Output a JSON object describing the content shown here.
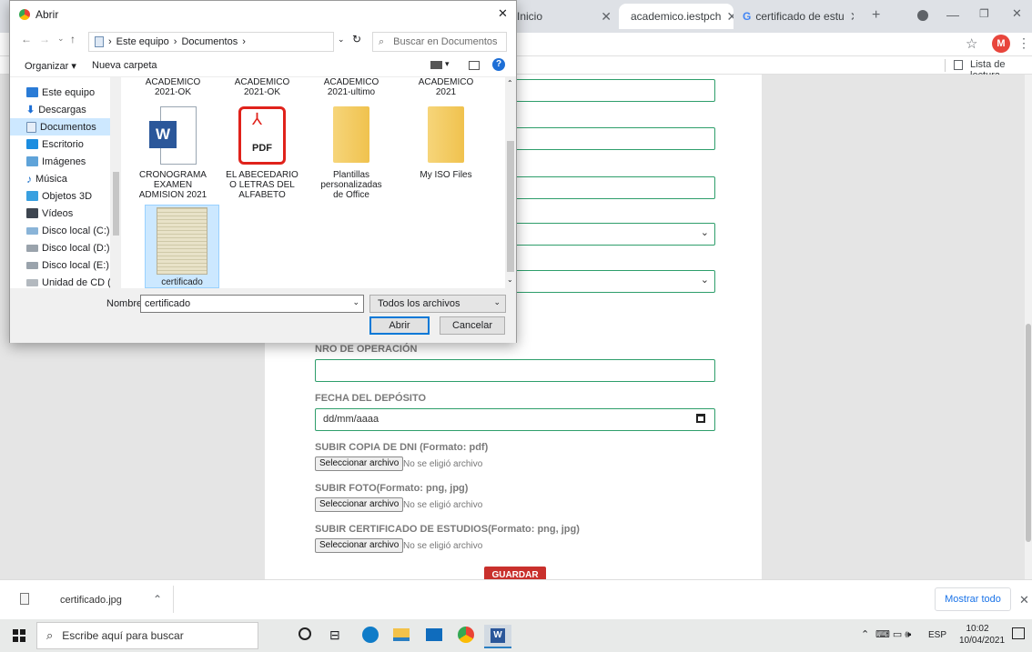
{
  "browser": {
    "tabs": [
      {
        "label": "Inicio",
        "icon": "globe-icon"
      },
      {
        "label": "academico.iestpch",
        "icon": "globe-icon",
        "active": true
      },
      {
        "label": "certificado de estu",
        "icon": "google-icon"
      }
    ],
    "new_tab": "+",
    "profile_initial": "M",
    "reading_list": "Lista de lectura"
  },
  "form": {
    "fields": [
      {
        "label": "NRO DE OPERACIÓN",
        "value": ""
      },
      {
        "label": "FECHA DEL DEPÓSITO",
        "placeholder": "dd/mm/aaaa"
      }
    ],
    "uploads": [
      {
        "label": "SUBIR COPIA DE DNI (Formato: pdf)",
        "button": "Seleccionar archivo",
        "status": "No se eligió archivo"
      },
      {
        "label": "SUBIR FOTO(Formato: png, jpg)",
        "button": "Seleccionar archivo",
        "status": "No se eligió archivo"
      },
      {
        "label": "SUBIR CERTIFICADO DE ESTUDIOS(Formato: png, jpg)",
        "button": "Seleccionar archivo",
        "status": "No se eligió archivo"
      }
    ],
    "save_label": "GUARDAR"
  },
  "dialog": {
    "title": "Abrir",
    "breadcrumb": [
      "Este equipo",
      "Documentos"
    ],
    "search_placeholder": "Buscar en Documentos",
    "organize": "Organizar ▾",
    "new_folder": "Nueva carpeta",
    "nav": [
      {
        "label": "Este equipo",
        "icon": "computer-icon"
      },
      {
        "label": "Descargas",
        "icon": "download-icon"
      },
      {
        "label": "Documentos",
        "icon": "document-icon",
        "selected": true
      },
      {
        "label": "Escritorio",
        "icon": "desktop-icon"
      },
      {
        "label": "Imágenes",
        "icon": "image-icon"
      },
      {
        "label": "Música",
        "icon": "music-icon"
      },
      {
        "label": "Objetos 3D",
        "icon": "cube-icon"
      },
      {
        "label": "Vídeos",
        "icon": "video-icon"
      },
      {
        "label": "Disco local (C:)",
        "icon": "drive-icon"
      },
      {
        "label": "Disco local (D:)",
        "icon": "drive-icon"
      },
      {
        "label": "Disco local (E:)",
        "icon": "drive-icon"
      },
      {
        "label": "Unidad de CD (H:",
        "icon": "cd-icon"
      }
    ],
    "top_files": [
      {
        "label": "ACADEMICO\n2021-OK"
      },
      {
        "label": "ACADEMICO\n2021-OK"
      },
      {
        "label": "ACADEMICO\n2021-ultimo"
      },
      {
        "label": "ACADEMICO\n2021"
      }
    ],
    "files": [
      {
        "label": "CRONOGRAMA\nEXAMEN\nADMISION 2021",
        "icon": "word-icon",
        "badge": "W"
      },
      {
        "label": "EL ABECEDARIO\nO LETRAS DEL\nALFABETO",
        "icon": "pdf-icon",
        "badge": "PDF"
      },
      {
        "label": "Plantillas\npersonalizadas\nde Office",
        "icon": "folder-icon"
      },
      {
        "label": "My ISO Files",
        "icon": "folder-icon"
      },
      {
        "label": "certificado",
        "icon": "image-thumb-icon",
        "selected": true
      }
    ],
    "filename_label": "Nombre:",
    "filename_value": "certificado",
    "filetype": "Todos los archivos",
    "open_label": "Abrir",
    "cancel_label": "Cancelar"
  },
  "downloads": {
    "item": "certificado.jpg",
    "show_all": "Mostrar todo"
  },
  "taskbar": {
    "search_placeholder": "Escribe aquí para buscar",
    "lang": "ESP",
    "time": "10:02",
    "date": "10/04/2021"
  },
  "colors": {
    "accent_green": "#2e9e6b",
    "save_red": "#c9302c",
    "profile": "#e8453c"
  }
}
